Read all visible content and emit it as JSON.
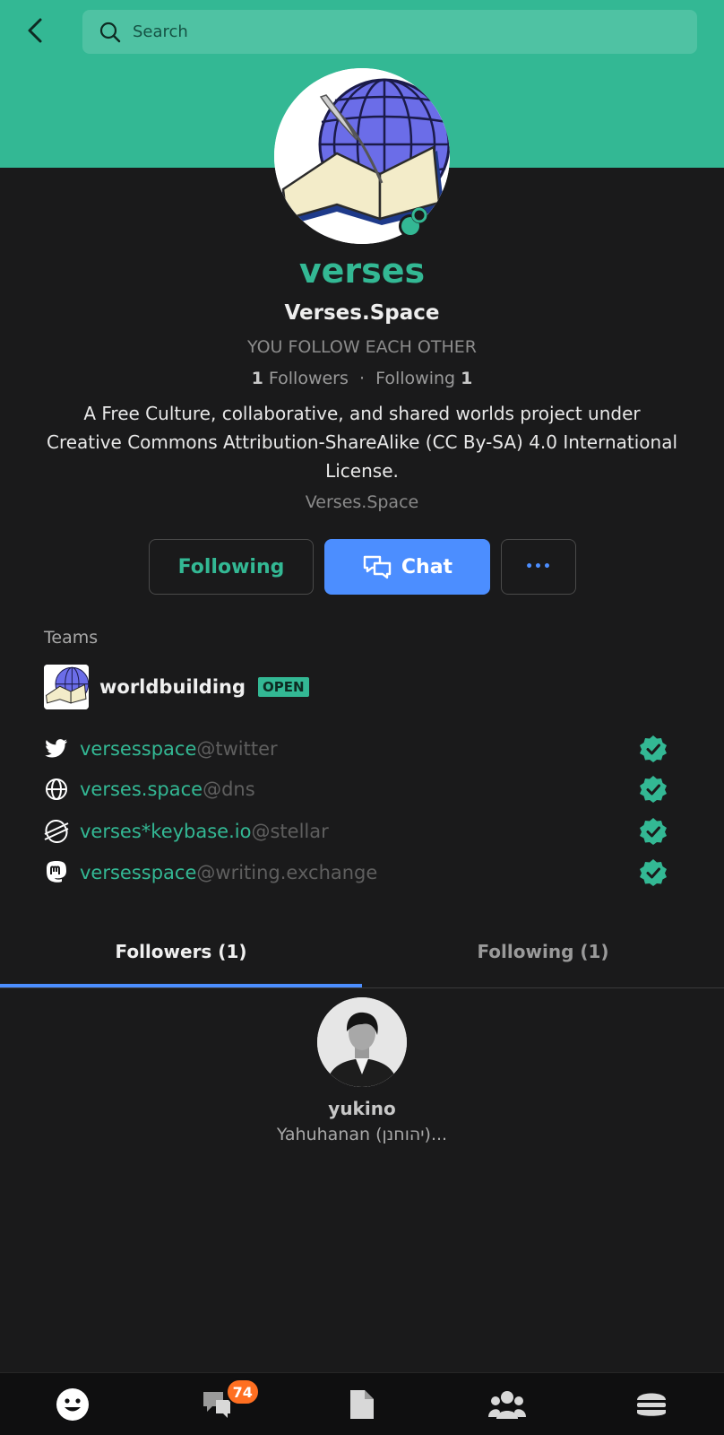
{
  "header": {
    "search_placeholder": "Search",
    "bg_color": "#33b894"
  },
  "profile": {
    "username": "verses",
    "full_name": "Verses.Space",
    "relation": "YOU FOLLOW EACH OTHER",
    "followers_count": "1",
    "followers_label": "Followers",
    "following_label": "Following",
    "following_count": "1",
    "separator": "·",
    "bio": "A Free Culture, collaborative, and shared worlds project under Creative Commons Attribution-ShareAlike (CC By-SA) 4.0 International License.",
    "website": "Verses.Space"
  },
  "actions": {
    "following_label": "Following",
    "chat_label": "Chat",
    "more_label": "•••"
  },
  "teams": {
    "heading": "Teams",
    "items": [
      {
        "name": "worldbuilding",
        "badge": "OPEN"
      }
    ]
  },
  "proofs": [
    {
      "icon": "twitter-icon",
      "name": "versesspace",
      "service": "@twitter",
      "verified": true
    },
    {
      "icon": "globe-icon",
      "name": "verses.space",
      "service": "@dns",
      "verified": true
    },
    {
      "icon": "stellar-icon",
      "name": "verses*keybase.io",
      "service": "@stellar",
      "verified": true
    },
    {
      "icon": "mastodon-icon",
      "name": "versesspace",
      "service": "@writing.exchange",
      "verified": true
    }
  ],
  "tabs": [
    {
      "label": "Followers (1)",
      "active": true
    },
    {
      "label": "Following (1)",
      "active": false
    }
  ],
  "followers": [
    {
      "username": "yukino",
      "full_name": "Yahuhanan (יהוחנן)..."
    }
  ],
  "bottom_nav": {
    "items": [
      {
        "icon": "people-face-icon"
      },
      {
        "icon": "chat-icon",
        "badge": "74"
      },
      {
        "icon": "files-icon"
      },
      {
        "icon": "teams-icon"
      },
      {
        "icon": "menu-burger-icon"
      }
    ]
  },
  "colors": {
    "accent_green": "#33b894",
    "accent_blue": "#4c8eff",
    "badge_orange": "#ff6f21",
    "background": "#1a1a1b"
  }
}
